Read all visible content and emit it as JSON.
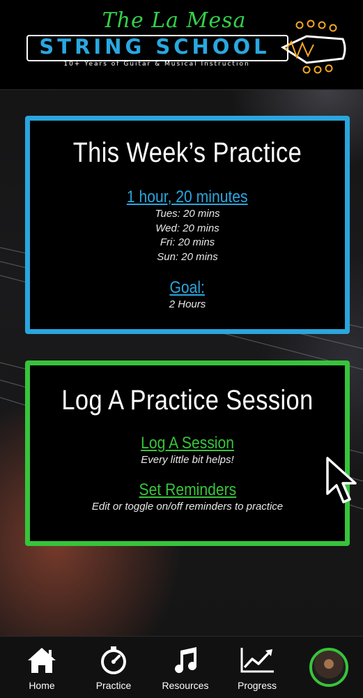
{
  "header": {
    "script_title": "The La Mesa",
    "school_name": "STRING SCHOOL",
    "tagline": "10+ Years of Guitar & Musical Instruction"
  },
  "week_card": {
    "title": "This Week’s Practice",
    "total_link": "1 hour, 20 minutes",
    "sessions": [
      "Tues: 20 mins",
      "Wed: 20 mins",
      "Fri: 20 mins",
      "Sun: 20 mins"
    ],
    "goal_link": "Goal:",
    "goal_value": "2 Hours"
  },
  "log_card": {
    "title": "Log A Practice Session",
    "log_link": "Log A Session",
    "log_sub": "Every little bit helps!",
    "reminders_link": "Set Reminders",
    "reminders_sub": "Edit or toggle on/off reminders to practice"
  },
  "tabbar": {
    "items": [
      {
        "label": "Home",
        "icon": "home-icon"
      },
      {
        "label": "Practice",
        "icon": "stopwatch-icon"
      },
      {
        "label": "Resources",
        "icon": "music-note-icon"
      },
      {
        "label": "Progress",
        "icon": "trend-chart-icon"
      },
      {
        "label": "",
        "icon": "profile-avatar"
      }
    ]
  },
  "colors": {
    "week_accent": "#2aa6dd",
    "log_accent": "#37c43a",
    "script_green": "#33d14a"
  }
}
